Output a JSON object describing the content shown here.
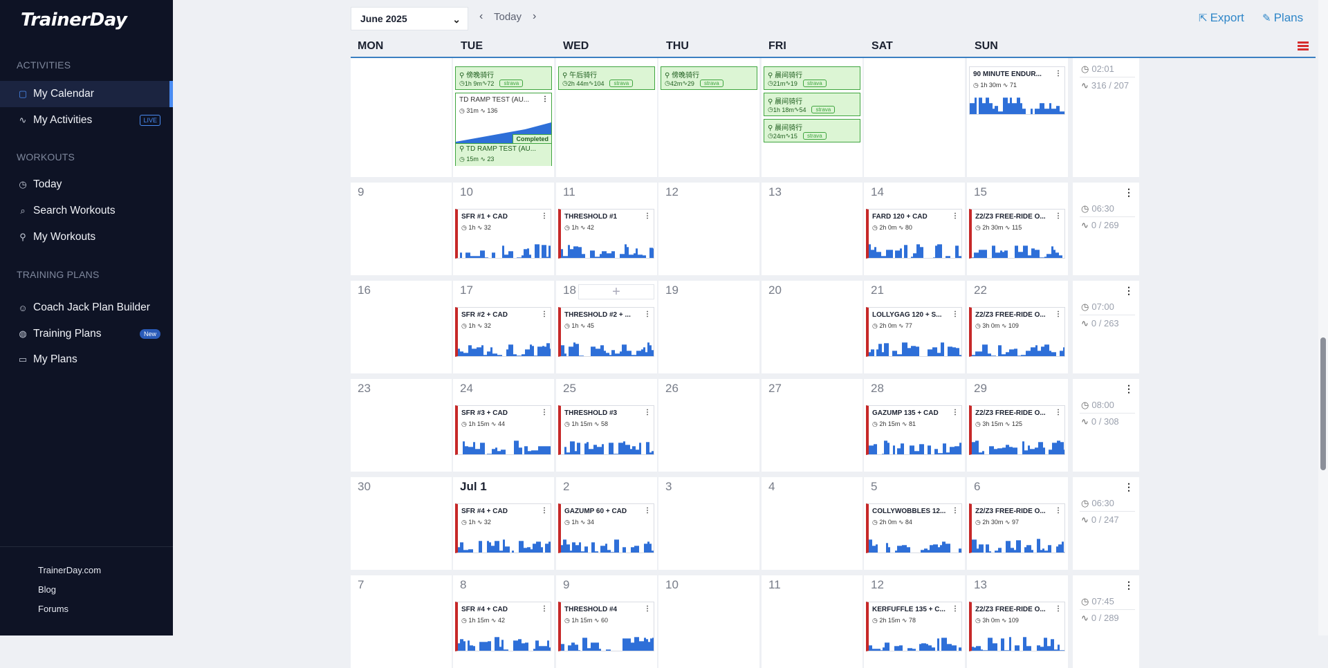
{
  "app": {
    "logo": "TrainerDay",
    "sections": {
      "activities": "ACTIVITIES",
      "workouts": "WORKOUTS",
      "training_plans": "TRAINING PLANS"
    },
    "nav": {
      "my_calendar": "My Calendar",
      "my_activities": "My Activities",
      "live_badge": "LIVE",
      "today": "Today",
      "search_workouts": "Search Workouts",
      "my_workouts": "My Workouts",
      "coach_jack": "Coach Jack Plan Builder",
      "training_plans": "Training Plans",
      "new_badge": "New",
      "my_plans": "My Plans"
    },
    "footer": {
      "site": "TrainerDay.com",
      "blog": "Blog",
      "forums": "Forums"
    },
    "accent_color": "#4a8cf2"
  },
  "toolbar": {
    "month": "June 2025",
    "today_label": "Today",
    "export_label": "Export",
    "plans_label": "Plans"
  },
  "weekdays": [
    "MON",
    "TUE",
    "WED",
    "THU",
    "FRI",
    "SAT",
    "SUN"
  ],
  "weeks": [
    {
      "days": [
        "",
        "",
        "",
        "",
        "",
        "",
        ""
      ],
      "summary": {
        "time": "02:01",
        "tss": "316 / 207"
      },
      "activities": [
        {
          "day": 1,
          "row": 0,
          "name": "傍晚骑行",
          "time": "1h 9m",
          "tss": "72",
          "source": "strava"
        },
        {
          "day": 2,
          "row": 0,
          "name": "午后骑行",
          "time": "2h 44m",
          "tss": "104",
          "source": "strava"
        },
        {
          "day": 3,
          "row": 0,
          "name": "傍晚骑行",
          "time": "42m",
          "tss": "29",
          "source": "strava"
        },
        {
          "day": 4,
          "row": 0,
          "name": "晨间骑行",
          "time": "21m",
          "tss": "19",
          "source": "strava"
        },
        {
          "day": 4,
          "row": 1,
          "name": "晨间骑行",
          "time": "1h 18m",
          "tss": "54",
          "source": "strava"
        },
        {
          "day": 4,
          "row": 2,
          "name": "晨间骑行",
          "time": "24m",
          "tss": "15",
          "source": "strava"
        }
      ],
      "ramp": {
        "name": "TD RAMP TEST (AU...",
        "time": "31m",
        "tss": "136",
        "completed": "Completed",
        "activity_name": "TD RAMP TEST (AU...",
        "activity_time": "15m",
        "activity_tss": "23"
      },
      "cards": [
        {
          "day": 6,
          "name": "90 MINUTE ENDUR...",
          "time": "1h 30m",
          "tss": "71",
          "plain": true
        }
      ]
    },
    {
      "days": [
        "9",
        "10",
        "11",
        "12",
        "13",
        "14",
        "15"
      ],
      "summary": {
        "time": "06:30",
        "tss": "0 / 269"
      },
      "cards": [
        {
          "day": 1,
          "name": "SFR #1 + CAD",
          "time": "1h",
          "tss": "32"
        },
        {
          "day": 2,
          "name": "THRESHOLD #1",
          "time": "1h",
          "tss": "42"
        },
        {
          "day": 5,
          "name": "FARD 120 + CAD",
          "time": "2h 0m",
          "tss": "80"
        },
        {
          "day": 6,
          "name": "Z2/Z3 FREE-RIDE O...",
          "time": "2h 30m",
          "tss": "115"
        }
      ]
    },
    {
      "days": [
        "16",
        "17",
        "18",
        "19",
        "20",
        "21",
        "22"
      ],
      "summary": {
        "time": "07:00",
        "tss": "0 / 263"
      },
      "add_slot": "+",
      "cards": [
        {
          "day": 1,
          "name": "SFR #2 + CAD",
          "time": "1h",
          "tss": "32"
        },
        {
          "day": 2,
          "name": "THRESHOLD #2 + ...",
          "time": "1h",
          "tss": "45"
        },
        {
          "day": 5,
          "name": "LOLLYGAG 120 + S...",
          "time": "2h 0m",
          "tss": "77"
        },
        {
          "day": 6,
          "name": "Z2/Z3 FREE-RIDE O...",
          "time": "3h 0m",
          "tss": "109"
        }
      ]
    },
    {
      "days": [
        "23",
        "24",
        "25",
        "26",
        "27",
        "28",
        "29"
      ],
      "summary": {
        "time": "08:00",
        "tss": "0 / 308"
      },
      "cards": [
        {
          "day": 1,
          "name": "SFR #3 + CAD",
          "time": "1h 15m",
          "tss": "44"
        },
        {
          "day": 2,
          "name": "THRESHOLD #3",
          "time": "1h 15m",
          "tss": "58"
        },
        {
          "day": 5,
          "name": "GAZUMP 135 + CAD",
          "time": "2h 15m",
          "tss": "81"
        },
        {
          "day": 6,
          "name": "Z2/Z3 FREE-RIDE O...",
          "time": "3h 15m",
          "tss": "125"
        }
      ]
    },
    {
      "days": [
        "30",
        "Jul 1",
        "2",
        "3",
        "4",
        "5",
        "6"
      ],
      "summary": {
        "time": "06:30",
        "tss": "0 / 247"
      },
      "cards": [
        {
          "day": 1,
          "name": "SFR #4 + CAD",
          "time": "1h",
          "tss": "32"
        },
        {
          "day": 2,
          "name": "GAZUMP 60 + CAD",
          "time": "1h",
          "tss": "34"
        },
        {
          "day": 5,
          "name": "COLLYWOBBLES 12...",
          "time": "2h 0m",
          "tss": "84"
        },
        {
          "day": 6,
          "name": "Z2/Z3 FREE-RIDE O...",
          "time": "2h 30m",
          "tss": "97"
        }
      ]
    },
    {
      "days": [
        "7",
        "8",
        "9",
        "10",
        "11",
        "12",
        "13"
      ],
      "summary": {
        "time": "07:45",
        "tss": "0 / 289"
      },
      "cards": [
        {
          "day": 1,
          "name": "SFR #4 + CAD",
          "time": "1h 15m",
          "tss": "42"
        },
        {
          "day": 2,
          "name": "THRESHOLD #4",
          "time": "1h 15m",
          "tss": "60"
        },
        {
          "day": 5,
          "name": "KERFUFFLE 135 + C...",
          "time": "2h 15m",
          "tss": "78"
        },
        {
          "day": 6,
          "name": "Z2/Z3 FREE-RIDE O...",
          "time": "3h 0m",
          "tss": "109"
        }
      ]
    }
  ]
}
